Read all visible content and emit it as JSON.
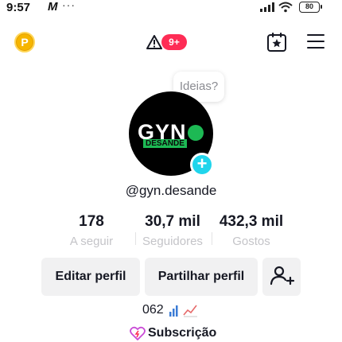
{
  "status_bar": {
    "time": "9:57",
    "carrier_glyph": "M",
    "more": "···",
    "battery": "80"
  },
  "top_nav": {
    "coin_label": "P",
    "notification_badge": "9+"
  },
  "tooltip": {
    "text": "Ideias?"
  },
  "profile": {
    "avatar_logo": "GYN",
    "avatar_logo_sub": "DESANDE",
    "username": "@gyn.desande"
  },
  "stats": [
    {
      "value": "178",
      "label": "A seguir"
    },
    {
      "value": "30,7 mil",
      "label": "Seguidores"
    },
    {
      "value": "432,3 mil",
      "label": "Gostos"
    }
  ],
  "actions": {
    "edit_profile": "Editar perfil",
    "share_profile": "Partilhar perfil"
  },
  "extras": {
    "views": "062",
    "subscription": "Subscrição"
  },
  "colors": {
    "accent_red": "#fe2c55",
    "accent_cyan": "#20d5ec",
    "coin_yellow": "#f6b500",
    "brand_green": "#1db954"
  }
}
